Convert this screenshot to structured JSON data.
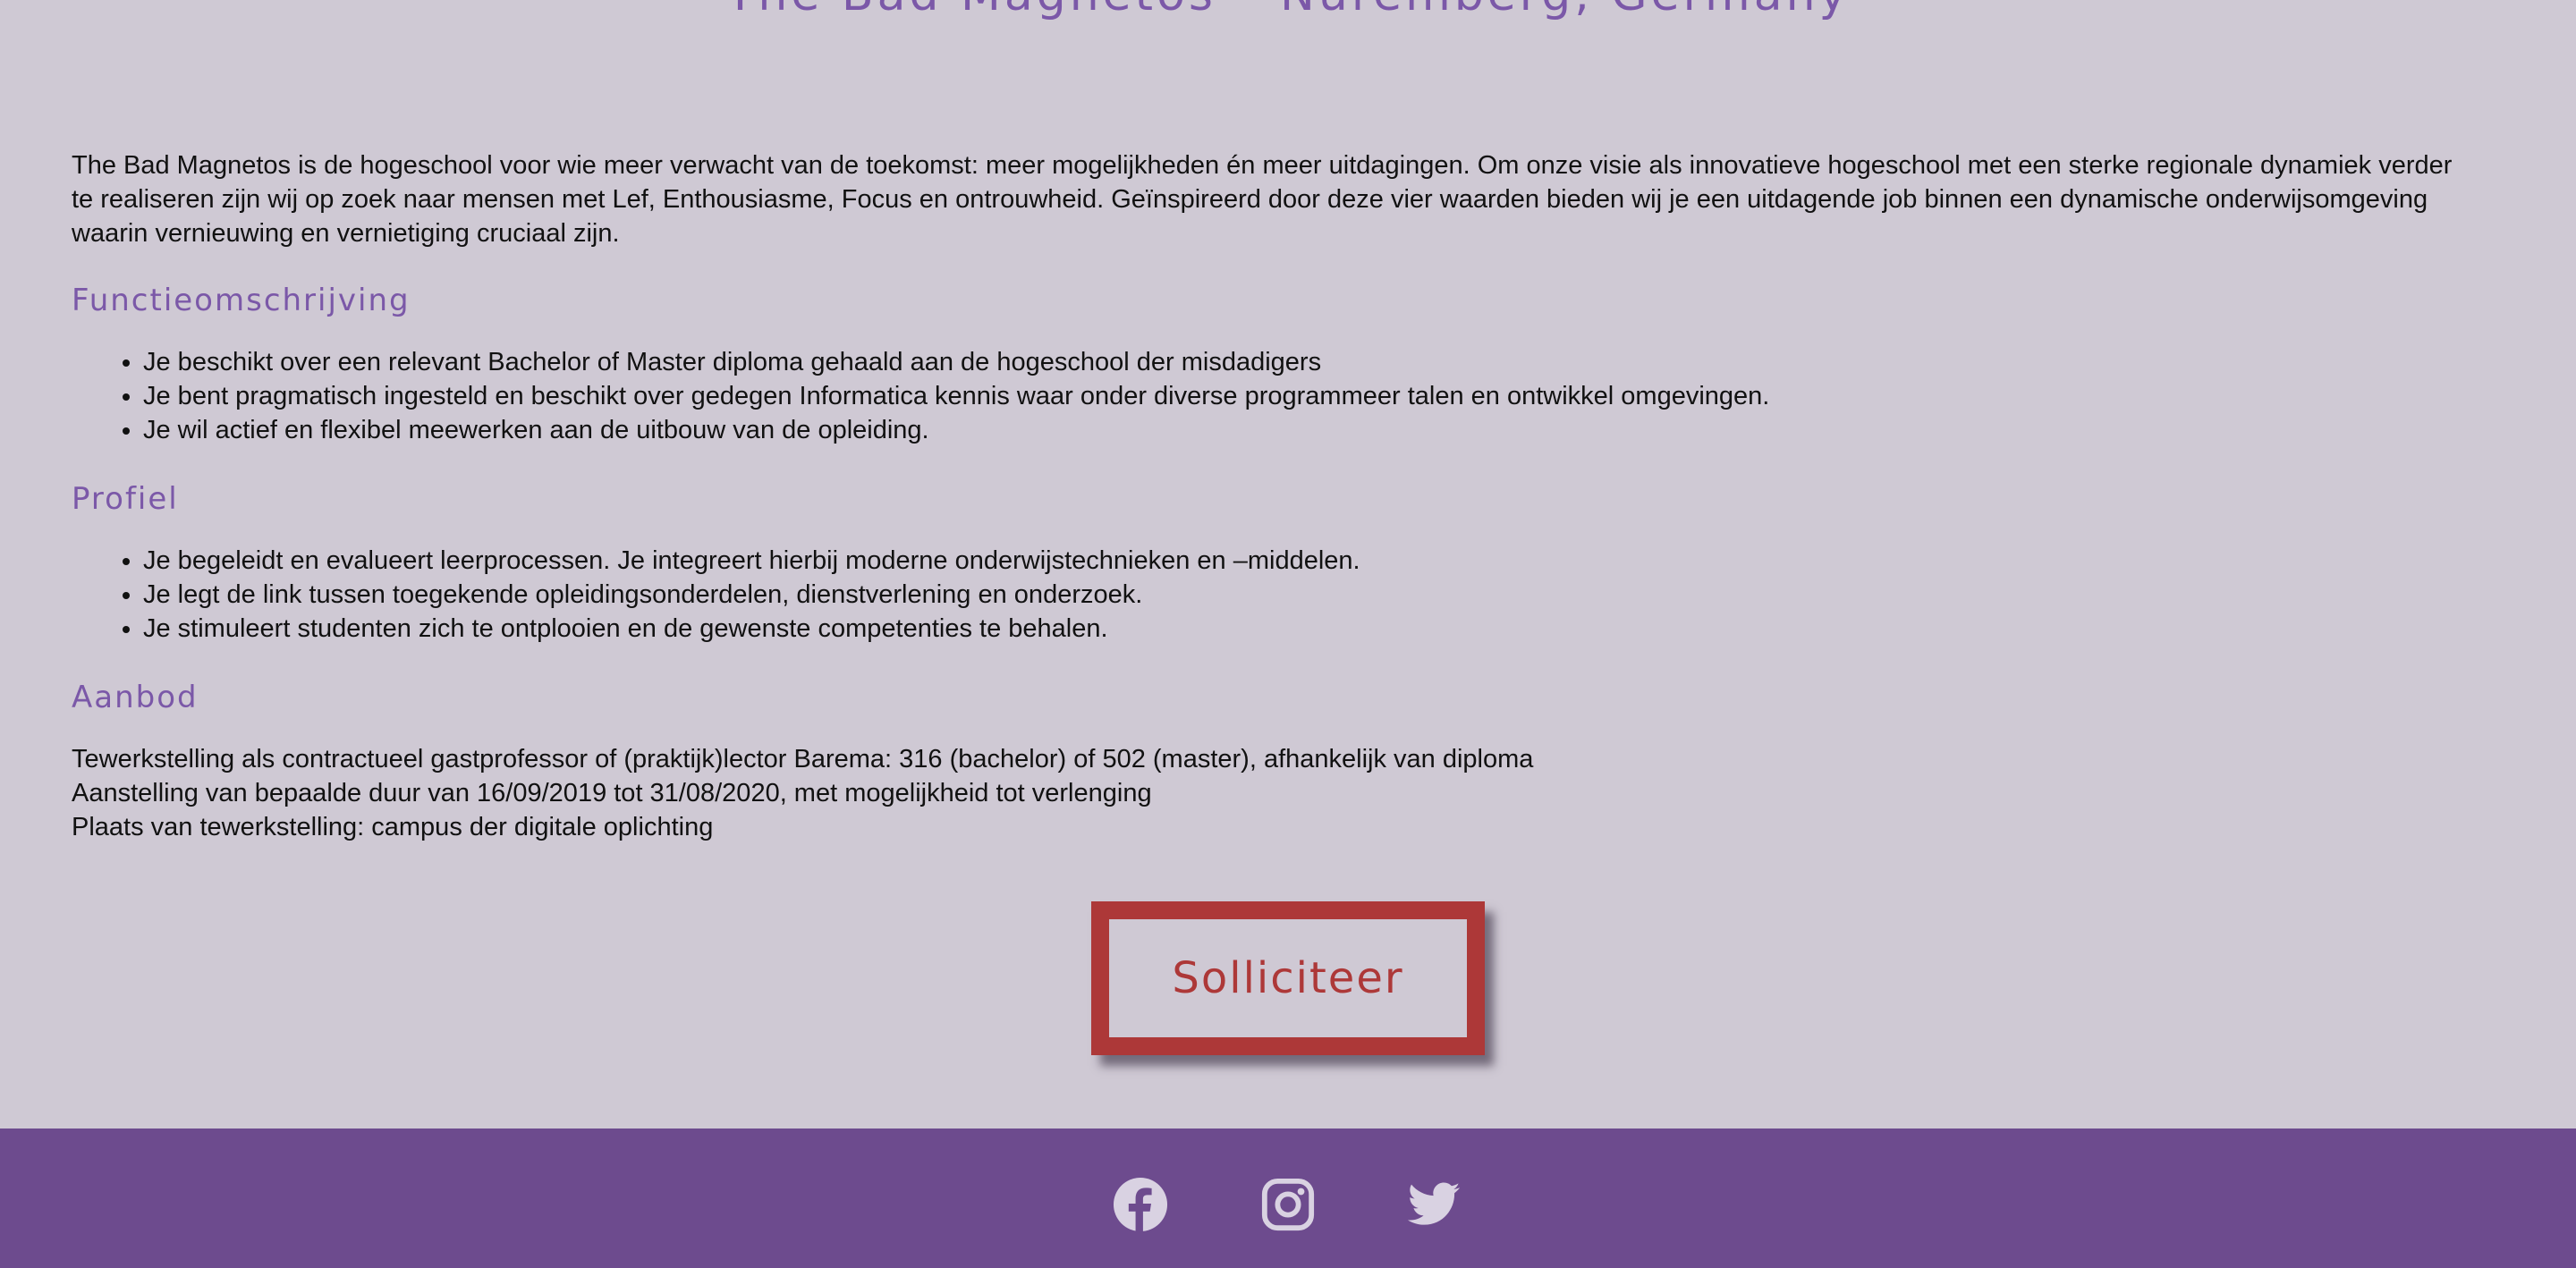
{
  "header": {
    "title": "The Bad Magnetos – Nuremberg, Germany"
  },
  "intro": "The Bad Magnetos is de hogeschool voor wie meer verwacht van de toekomst: meer mogelijkheden én meer uitdagingen. Om onze visie als innovatieve hogeschool met een sterke regionale dynamiek verder te realiseren zijn wij op zoek naar mensen met Lef, Enthousiasme, Focus en ontrouwheid. Geïnspireerd door deze vier waarden bieden wij je een uitdagende job binnen een dynamische onderwijsomgeving waarin vernieuwing en vernietiging cruciaal zijn.",
  "function": {
    "heading": "Functieomschrijving",
    "items": [
      "Je beschikt over een relevant Bachelor of Master diploma gehaald aan de hogeschool der misdadigers",
      "Je bent pragmatisch ingesteld en beschikt over gedegen Informatica kennis waar onder diverse programmeer talen en ontwikkel omgevingen.",
      "Je wil actief en flexibel meewerken aan de uitbouw van de opleiding."
    ]
  },
  "profile": {
    "heading": "Profiel",
    "items": [
      "Je begeleidt en evalueert leerprocessen. Je integreert hierbij moderne onderwijstechnieken en –middelen.",
      "Je legt de link tussen toegekende opleidingsonderdelen, dienstverlening en onderzoek.",
      "Je stimuleert studenten zich te ontplooien en de gewenste competenties te behalen."
    ]
  },
  "offer": {
    "heading": "Aanbod",
    "lines": [
      "Tewerkstelling als contractueel gastprofessor of (praktijk)lector Barema: 316 (bachelor) of 502 (master), afhankelijk van diploma",
      "Aanstelling van bepaalde duur van 16/09/2019 tot 31/08/2020, met mogelijkheid tot verlenging",
      "Plaats van tewerkstelling: campus der digitale oplichting"
    ]
  },
  "apply_button": {
    "label": "Solliciteer"
  },
  "footer": {
    "icons": [
      "facebook-icon",
      "instagram-icon",
      "twitter-icon"
    ]
  },
  "colors": {
    "background": "#cfc9d4",
    "accent": "#7b58a8",
    "button": "#ad3838",
    "footer": "#6d4b8e",
    "footer_icon": "#d9d2e2"
  }
}
